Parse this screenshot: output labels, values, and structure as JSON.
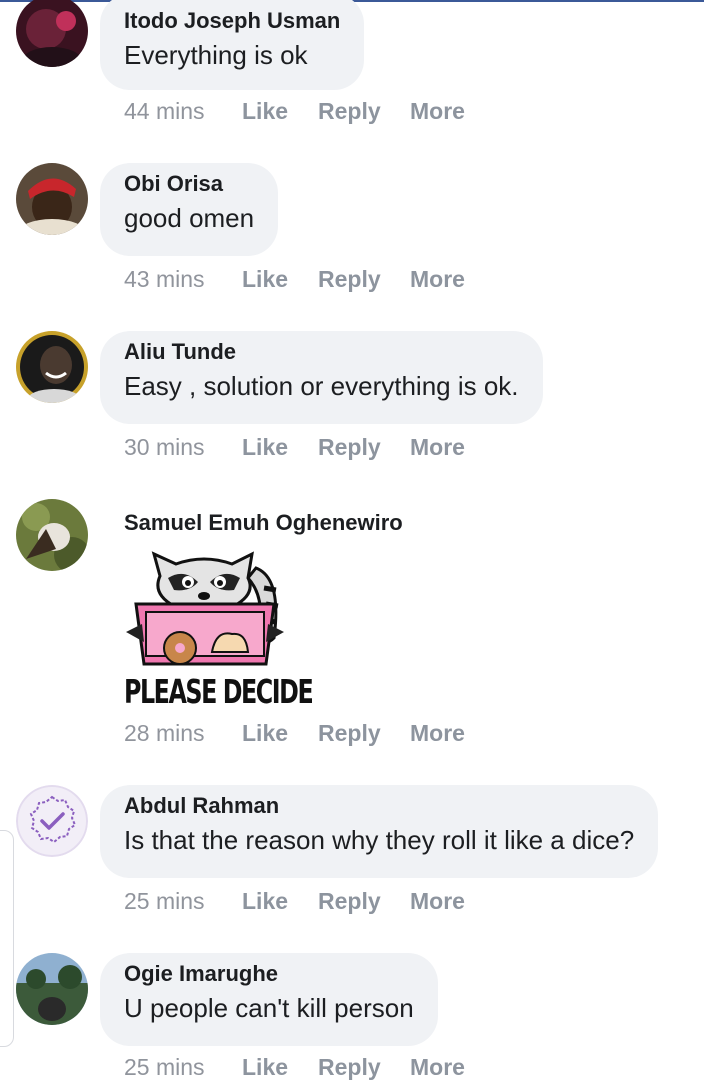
{
  "comments": [
    {
      "author": "Itodo Joseph Usman",
      "text": "Everything is ok",
      "time": "44 mins",
      "avatar_icon": "profile-photo-dark-red"
    },
    {
      "author": "Obi Orisa",
      "text": "good omen",
      "time": "43 mins",
      "avatar_icon": "profile-photo-red-cap"
    },
    {
      "author": "Aliu Tunde",
      "text": "Easy , solution or everything is ok.",
      "time": "30 mins",
      "avatar_icon": "profile-photo-smiling-man"
    },
    {
      "author": "Samuel Emuh Oghenewiro",
      "sticker_caption": "PLEASE DECIDE",
      "sticker_icon": "raccoon-donut-box-sticker",
      "time": "28 mins",
      "avatar_icon": "profile-photo-outdoors"
    },
    {
      "author": "Abdul Rahman",
      "text": "Is that the reason why they roll it like a dice?",
      "time": "25 mins",
      "avatar_icon": "verified-badge-avatar"
    },
    {
      "author": "Ogie Imarughe",
      "text": "U people can't kill person",
      "time": "25 mins",
      "avatar_icon": "profile-photo-landscape"
    }
  ],
  "actions": {
    "like": "Like",
    "reply": "Reply",
    "more": "More"
  },
  "colors": {
    "bubble": "#f0f2f5",
    "meta_text": "#8d949e",
    "accent": "#3b5998",
    "badge": "#8b5fbf"
  }
}
